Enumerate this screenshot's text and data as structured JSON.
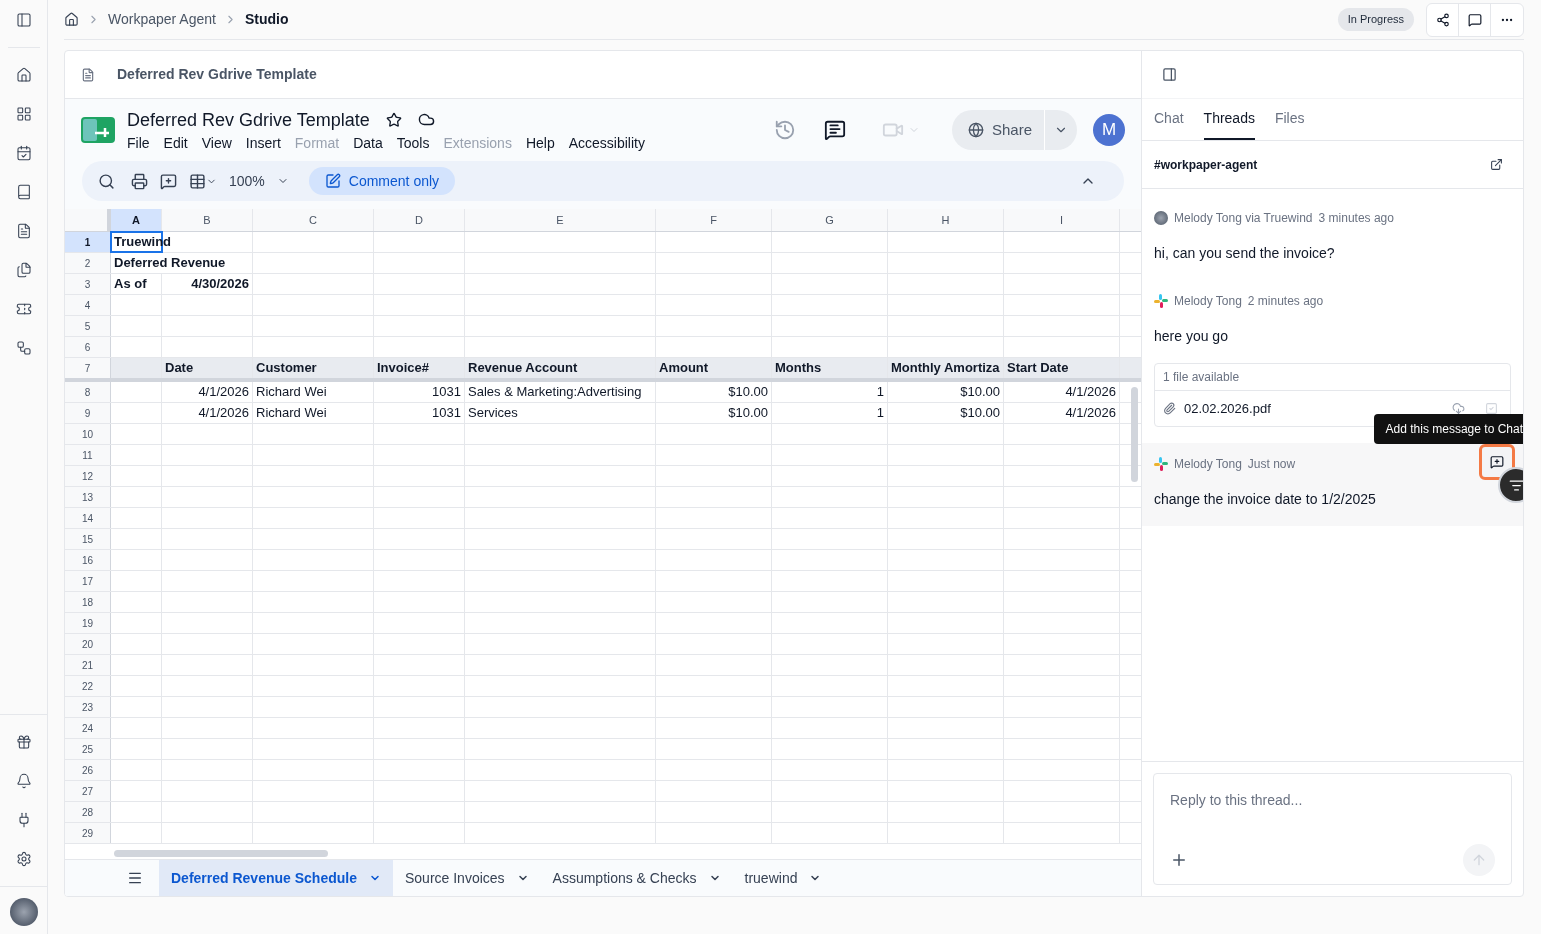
{
  "breadcrumb": [
    {
      "label": "Workpaper Agent",
      "current": false
    },
    {
      "label": "Studio",
      "current": true
    }
  ],
  "status_badge": "In Progress",
  "document": {
    "title": "Deferred Rev Gdrive Template"
  },
  "sheet": {
    "title": "Deferred Rev Gdrive Template",
    "starred": false,
    "menu": [
      {
        "label": "File",
        "disabled": false
      },
      {
        "label": "Edit",
        "disabled": false
      },
      {
        "label": "View",
        "disabled": false
      },
      {
        "label": "Insert",
        "disabled": false
      },
      {
        "label": "Format",
        "disabled": true
      },
      {
        "label": "Data",
        "disabled": false
      },
      {
        "label": "Tools",
        "disabled": false
      },
      {
        "label": "Extensions",
        "disabled": true
      },
      {
        "label": "Help",
        "disabled": false
      },
      {
        "label": "Accessibility",
        "disabled": false
      }
    ],
    "share": "Share",
    "avatar": "M",
    "zoom": "100%",
    "mode": "Comment only",
    "columns": [
      {
        "label": "A",
        "selected": true
      },
      {
        "label": "B",
        "selected": false
      },
      {
        "label": "C",
        "selected": false
      },
      {
        "label": "D",
        "selected": false
      },
      {
        "label": "E",
        "selected": false
      },
      {
        "label": "F",
        "selected": false
      },
      {
        "label": "G",
        "selected": false
      },
      {
        "label": "H",
        "selected": false
      },
      {
        "label": "I",
        "selected": false
      }
    ],
    "rows": [
      {
        "number": "1",
        "kind": "title",
        "selected": true,
        "cells": {
          "A": {
            "text": "Truewind",
            "numeric": false
          }
        }
      },
      {
        "number": "2",
        "kind": "title",
        "selected": false,
        "cells": {
          "A": {
            "text": "Deferred Revenue",
            "numeric": false
          }
        }
      },
      {
        "number": "3",
        "kind": "title",
        "selected": false,
        "cells": {
          "A": {
            "text": "As of",
            "numeric": false
          },
          "B": {
            "text": "4/30/2026",
            "numeric": true
          }
        }
      },
      {
        "number": "4",
        "kind": "data",
        "selected": false
      },
      {
        "number": "5",
        "kind": "data",
        "selected": false
      },
      {
        "number": "6",
        "kind": "data",
        "selected": false
      },
      {
        "number": "7",
        "kind": "header",
        "selected": false,
        "cells": {
          "B": {
            "text": "Date",
            "numeric": false
          },
          "C": {
            "text": "Customer",
            "numeric": false
          },
          "D": {
            "text": "Invoice#",
            "numeric": false
          },
          "E": {
            "text": "Revenue Account",
            "numeric": false
          },
          "F": {
            "text": "Amount",
            "numeric": false
          },
          "G": {
            "text": "Months",
            "numeric": false
          },
          "H": {
            "text": "Monthly Amortiza",
            "numeric": false
          },
          "I": {
            "text": "Start Date",
            "numeric": false
          }
        }
      },
      {
        "number": "8",
        "kind": "data",
        "selected": false,
        "cells": {
          "B": {
            "text": "4/1/2026",
            "numeric": true
          },
          "C": {
            "text": "Richard Wei",
            "numeric": false
          },
          "D": {
            "text": "1031",
            "numeric": true
          },
          "E": {
            "text": "Sales & Marketing:Advertising",
            "numeric": false
          },
          "F": {
            "text": "$10.00",
            "numeric": true
          },
          "G": {
            "text": "1",
            "numeric": true
          },
          "H": {
            "text": "$10.00",
            "numeric": true
          },
          "I": {
            "text": "4/1/2026",
            "numeric": true
          }
        }
      },
      {
        "number": "9",
        "kind": "data",
        "selected": false,
        "cells": {
          "B": {
            "text": "4/1/2026",
            "numeric": true
          },
          "C": {
            "text": "Richard Wei",
            "numeric": false
          },
          "D": {
            "text": "1031",
            "numeric": true
          },
          "E": {
            "text": "Services",
            "numeric": false
          },
          "F": {
            "text": "$10.00",
            "numeric": true
          },
          "G": {
            "text": "1",
            "numeric": true
          },
          "H": {
            "text": "$10.00",
            "numeric": true
          },
          "I": {
            "text": "4/1/2026",
            "numeric": true
          }
        }
      },
      {
        "number": "10",
        "kind": "data",
        "selected": false
      },
      {
        "number": "11",
        "kind": "data",
        "selected": false
      },
      {
        "number": "12",
        "kind": "data",
        "selected": false
      },
      {
        "number": "13",
        "kind": "data",
        "selected": false
      },
      {
        "number": "14",
        "kind": "data",
        "selected": false
      },
      {
        "number": "15",
        "kind": "data",
        "selected": false
      },
      {
        "number": "16",
        "kind": "data",
        "selected": false
      },
      {
        "number": "17",
        "kind": "data",
        "selected": false
      },
      {
        "number": "18",
        "kind": "data",
        "selected": false
      },
      {
        "number": "19",
        "kind": "data",
        "selected": false
      },
      {
        "number": "20",
        "kind": "data",
        "selected": false
      },
      {
        "number": "21",
        "kind": "data",
        "selected": false
      },
      {
        "number": "22",
        "kind": "data",
        "selected": false
      },
      {
        "number": "23",
        "kind": "data",
        "selected": false
      },
      {
        "number": "24",
        "kind": "data",
        "selected": false
      },
      {
        "number": "25",
        "kind": "data",
        "selected": false
      },
      {
        "number": "26",
        "kind": "data",
        "selected": false
      },
      {
        "number": "27",
        "kind": "data",
        "selected": false
      },
      {
        "number": "28",
        "kind": "data",
        "selected": false
      },
      {
        "number": "29",
        "kind": "data",
        "selected": false
      }
    ],
    "tabs": [
      {
        "label": "Deferred Revenue Schedule",
        "selected": true
      },
      {
        "label": "Source Invoices",
        "selected": false
      },
      {
        "label": "Assumptions & Checks",
        "selected": false
      },
      {
        "label": "truewind",
        "selected": false
      }
    ]
  },
  "panel": {
    "tabs": [
      {
        "label": "Chat",
        "selected": false
      },
      {
        "label": "Threads",
        "selected": true
      },
      {
        "label": "Files",
        "selected": false
      }
    ],
    "channel": "#workpaper-agent",
    "messages": [
      {
        "author": "Melody Tong via Truewind",
        "time": "3 minutes ago",
        "kind": "photo",
        "text": "hi, can you send the invoice?",
        "hovered": false
      },
      {
        "author": "Melody Tong",
        "time": "2 minutes ago",
        "kind": "app",
        "text": "here you go",
        "hovered": false,
        "attachments": {
          "title": "1 file available",
          "files": [
            "02.02.2026.pdf"
          ]
        }
      },
      {
        "author": "Melody Tong",
        "time": "Just now",
        "kind": "app",
        "text": "change the invoice date to 1/2/2025",
        "hovered": true,
        "tooltip": "Add this message to Chat"
      }
    ],
    "reply_placeholder": "Reply to this thread..."
  }
}
